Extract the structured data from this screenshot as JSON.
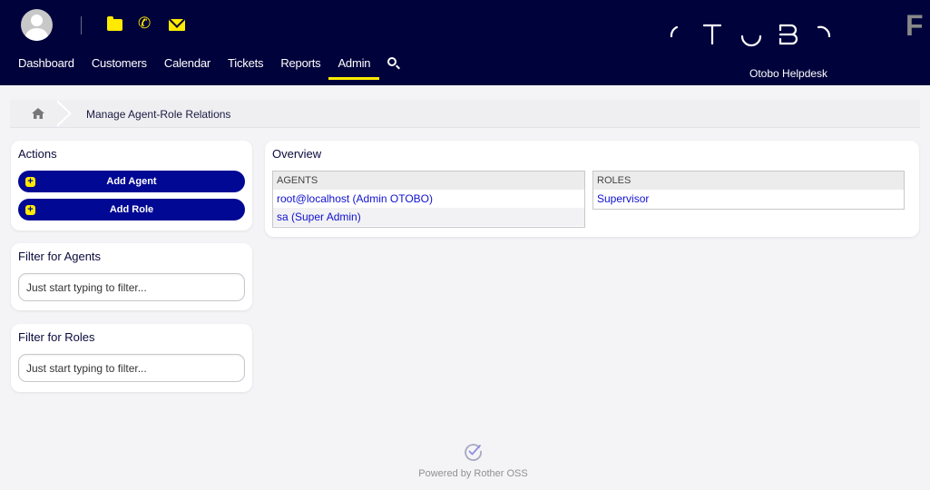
{
  "header": {
    "quick_icons": [
      "folder-icon",
      "phone-icon",
      "mail-icon"
    ],
    "nav": [
      {
        "label": "Dashboard",
        "active": false
      },
      {
        "label": "Customers",
        "active": false
      },
      {
        "label": "Calendar",
        "active": false
      },
      {
        "label": "Tickets",
        "active": false
      },
      {
        "label": "Reports",
        "active": false
      },
      {
        "label": "Admin",
        "active": true
      }
    ],
    "logo_text": "OTOBO",
    "subtitle": "Otobo Helpdesk",
    "corner_letter": "F"
  },
  "breadcrumb": {
    "current": "Manage Agent-Role Relations"
  },
  "sidebar": {
    "actions": {
      "title": "Actions",
      "buttons": [
        {
          "label": "Add Agent"
        },
        {
          "label": "Add Role"
        }
      ]
    },
    "filter_agents": {
      "title": "Filter for Agents",
      "placeholder": "Just start typing to filter..."
    },
    "filter_roles": {
      "title": "Filter for Roles",
      "placeholder": "Just start typing to filter..."
    }
  },
  "overview": {
    "title": "Overview",
    "agents": {
      "header": "AGENTS",
      "rows": [
        "root@localhost (Admin OTOBO)",
        "sa (Super Admin)"
      ]
    },
    "roles": {
      "header": "ROLES",
      "rows": [
        "Supervisor"
      ]
    }
  },
  "footer": {
    "text": "Powered by Rother OSS"
  },
  "colors": {
    "header_bg": "#00023c",
    "accent_yellow": "#ffea00",
    "button_blue": "#000894",
    "link_blue": "#1010d0"
  }
}
